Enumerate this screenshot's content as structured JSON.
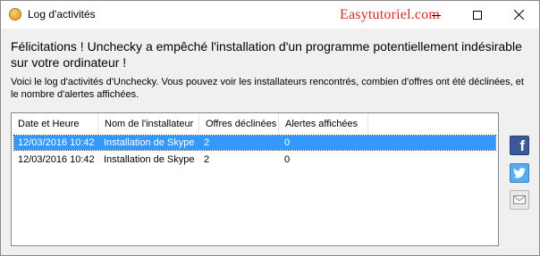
{
  "window": {
    "title": "Log d'activités",
    "watermark": "Easytutoriel.com"
  },
  "message": {
    "headline": "Félicitations ! Unchecky a empêché l'installation d'un programme potentiellement indésirable sur votre ordinateur !",
    "description": "Voici le log d'activités d'Unchecky. Vous pouvez voir les installateurs rencontrés, combien d'offres ont été déclinées, et le nombre d'alertes affichées."
  },
  "table": {
    "columns": [
      "Date et Heure",
      "Nom de l'installateur",
      "Offres déclinées",
      "Alertes affichées"
    ],
    "rows": [
      [
        "12/03/2016 10:42",
        "Installation de Skype",
        "2",
        "0"
      ],
      [
        "12/03/2016 10:42",
        "Installation de Skype",
        "2",
        "0"
      ]
    ],
    "selected_row": 0
  },
  "share": {
    "icons": [
      "facebook-icon",
      "twitter-icon",
      "email-icon"
    ],
    "colors": {
      "facebook": "#3b5998",
      "twitter": "#55acee",
      "email": "#e8e8e8"
    }
  },
  "colors": {
    "selection": "#3399ff",
    "watermark": "#d8292f"
  }
}
